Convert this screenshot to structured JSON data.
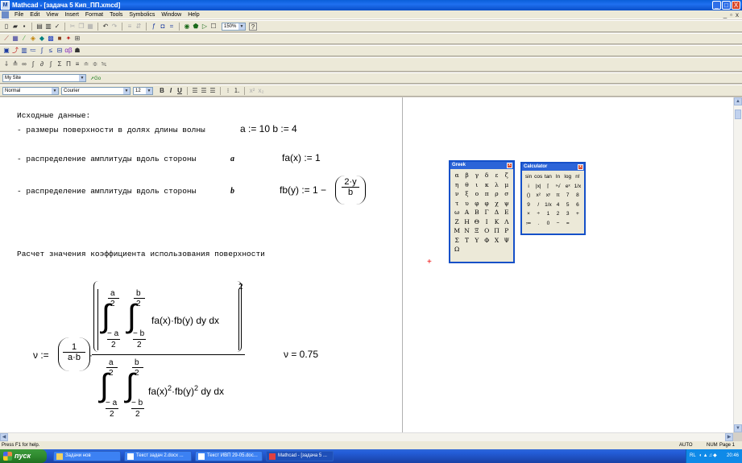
{
  "window": {
    "title": "Mathcad - [задача 5 Кип_ПП.xmcd]",
    "app_icon": "M",
    "controls": [
      "_",
      "□",
      "X"
    ],
    "mdi_controls": [
      "_",
      "▫",
      "x"
    ]
  },
  "menu": [
    "File",
    "Edit",
    "View",
    "Insert",
    "Format",
    "Tools",
    "Symbolics",
    "Window",
    "Help"
  ],
  "toolbar": {
    "zoom": "150%",
    "help": "?",
    "resource_combo": "My Site",
    "go_label": "Go",
    "style_combo": "Normal",
    "font_combo": "Courier",
    "size_combo": "12",
    "bold": "B",
    "italic": "I",
    "underline": "U"
  },
  "doc": {
    "heading": "Исходные данные:",
    "line1": "- размеры поверхности в долях длины волны",
    "line1_math": "a := 10  b := 4",
    "line2": "- распределение амплитуды вдоль стороны",
    "line2_var": "a",
    "line2_math": "fa(x) := 1",
    "line3": "- распределение амплитуды вдоль стороны",
    "line3_var": "b",
    "line3_math_left": "fb(y) := 1 −",
    "line3_num": "2·y",
    "line3_den": "b",
    "section2": "Расчет значения коэффициента использования поверхности",
    "nu_assign": "ν :=",
    "one": "1",
    "ab": "a·b",
    "dot": "·",
    "a": "a",
    "b": "b",
    "two": "2",
    "neg_a": "− a",
    "neg_b": "− b",
    "num_integrand": "fa(x)·fb(y) dy dx",
    "den_integrand_1": "fa(x)",
    "den_integrand_2": "·fb(y)",
    "den_integrand_3": " dy dx",
    "exp": "2",
    "nu_result": "ν = 0.75",
    "cursor": "+"
  },
  "greek": {
    "title": "Greek",
    "symbols": [
      "α",
      "β",
      "γ",
      "δ",
      "ε",
      "ζ",
      "η",
      "θ",
      "ι",
      "κ",
      "λ",
      "μ",
      "ν",
      "ξ",
      "ο",
      "π",
      "ρ",
      "σ",
      "τ",
      "υ",
      "φ",
      "φ",
      "χ",
      "ψ",
      "ω",
      "Α",
      "Β",
      "Γ",
      "Δ",
      "Ε",
      "Ζ",
      "Η",
      "Θ",
      "Ι",
      "Κ",
      "Λ",
      "Μ",
      "Ν",
      "Ξ",
      "Ο",
      "Π",
      "Ρ",
      "Σ",
      "Τ",
      "Υ",
      "Φ",
      "Χ",
      "Ψ",
      "Ω"
    ]
  },
  "calculator": {
    "title": "Calculator",
    "keys": [
      "sin",
      "cos",
      "tan",
      "ln",
      "log",
      "n!",
      "i",
      "|x|",
      "⌈",
      "ⁿ√",
      "eˣ",
      "1/x",
      "()",
      "x²",
      "xʸ",
      "π",
      "7",
      "8",
      "9",
      "/",
      "1/x",
      "4",
      "5",
      "6",
      "×",
      "÷",
      "1",
      "2",
      "3",
      "+",
      "≔",
      ".",
      "0",
      "−",
      "="
    ]
  },
  "status": {
    "help": "Press F1 for help.",
    "calc_mode": "AUTO",
    "num": "NUM",
    "page": "Page 1"
  },
  "taskbar": {
    "start": "пуск",
    "tasks": [
      "Задачи нов",
      "Текст задач 2.docx ...",
      "Текст ИВП 29-05.doc...",
      "Mathcad - [задача 5 ..."
    ],
    "lang": "RL",
    "clock": "20:46"
  }
}
